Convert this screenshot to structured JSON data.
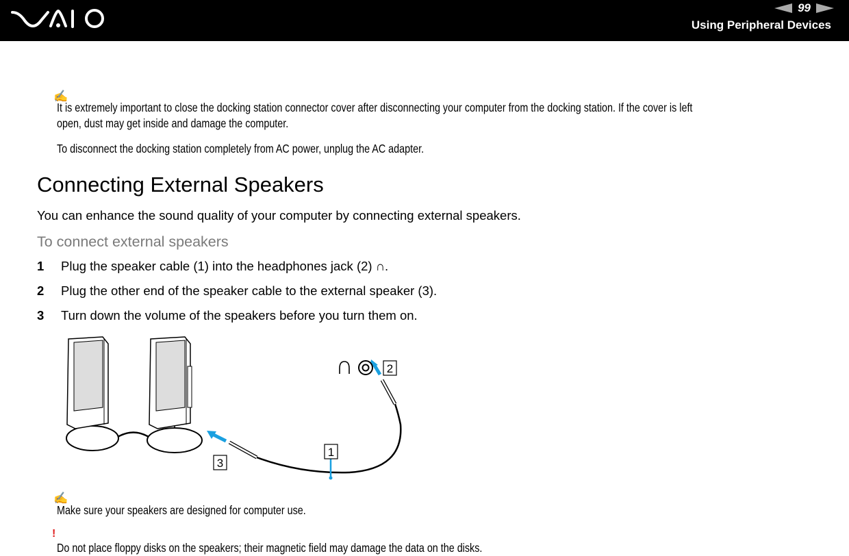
{
  "header": {
    "logo_text": "VAIO",
    "page_number": "99",
    "section_title": "Using Peripheral Devices"
  },
  "notes": {
    "note1_icon": "✍",
    "note1_line1": "It is extremely important to close the docking station connector cover after disconnecting your computer from the docking station. If the cover is left",
    "note1_line2": "open, dust may get inside and damage the computer.",
    "note1_para2": "To disconnect the docking station completely from AC power, unplug the AC adapter."
  },
  "section": {
    "title": "Connecting External Speakers",
    "intro": "You can enhance the sound quality of your computer by connecting external speakers.",
    "procedure_title": "To connect external speakers",
    "steps": [
      {
        "num": "1",
        "text": "Plug the speaker cable (1) into the headphones jack (2) ∩."
      },
      {
        "num": "2",
        "text": "Plug the other end of the speaker cable to the external speaker (3)."
      },
      {
        "num": "3",
        "text": "Turn down the volume of the speakers before you turn them on."
      }
    ]
  },
  "figure": {
    "callouts": [
      "1",
      "2",
      "3"
    ],
    "icons": [
      "headphones-icon",
      "audio-jack-icon"
    ],
    "accent_color": "#1aa0e0"
  },
  "footer_notes": {
    "note_icon": "✍",
    "note_text": "Make sure your speakers are designed for computer use.",
    "warning_icon": "!",
    "warning_text": "Do not place floppy disks on the speakers; their magnetic field may damage the data on the disks."
  }
}
